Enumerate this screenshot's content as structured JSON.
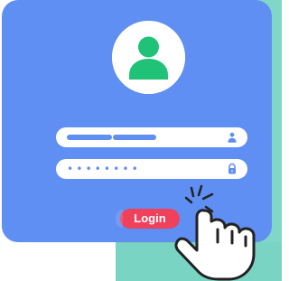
{
  "ui": {
    "background_accent": "#7fd8c7",
    "card_color": "#5f8ff2",
    "avatar_color": "#1fc276",
    "button_color": "#f0415c"
  },
  "login_form": {
    "password_mask": "••••••••",
    "login_label": "Login"
  },
  "icons": {
    "avatar": "user-avatar-icon",
    "username": "user-icon",
    "password": "lock-icon",
    "cursor": "hand-pointer-icon"
  }
}
